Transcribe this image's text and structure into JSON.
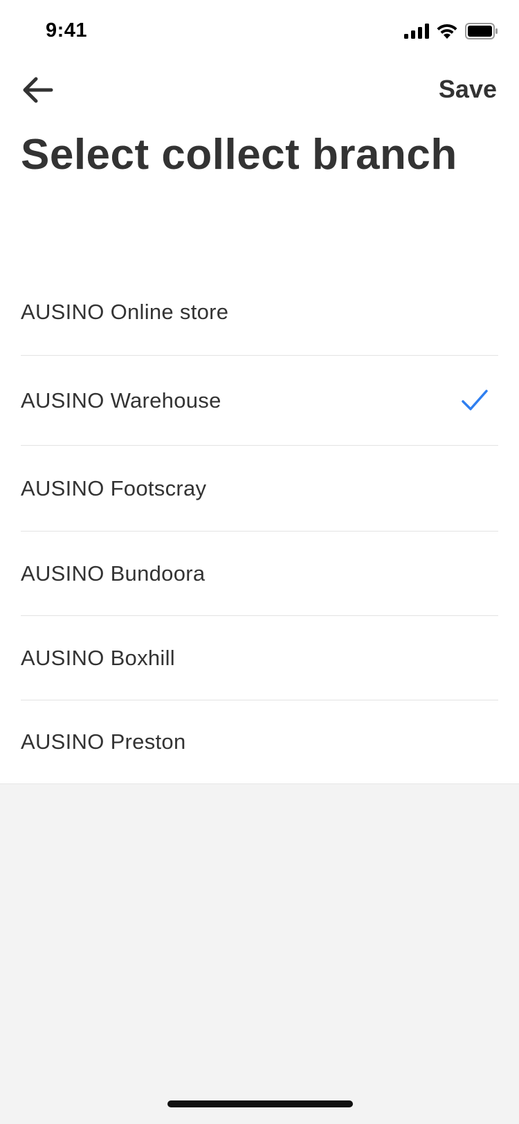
{
  "status_bar": {
    "time": "9:41",
    "icons": [
      "cellular-signal-icon",
      "wifi-icon",
      "battery-icon"
    ]
  },
  "nav": {
    "back_icon": "arrow-left-icon",
    "save_label": "Save"
  },
  "page": {
    "title": "Select collect branch"
  },
  "branches": [
    {
      "label": "AUSINO Online store",
      "selected": false
    },
    {
      "label": "AUSINO Warehouse",
      "selected": true
    },
    {
      "label": "AUSINO Footscray",
      "selected": false
    },
    {
      "label": "AUSINO Bundoora",
      "selected": false
    },
    {
      "label": "AUSINO Boxhill",
      "selected": false
    },
    {
      "label": "AUSINO Preston",
      "selected": false
    }
  ],
  "colors": {
    "accent": "#2f7ff0",
    "text": "#333333",
    "background": "#f3f3f3",
    "surface": "#ffffff"
  }
}
